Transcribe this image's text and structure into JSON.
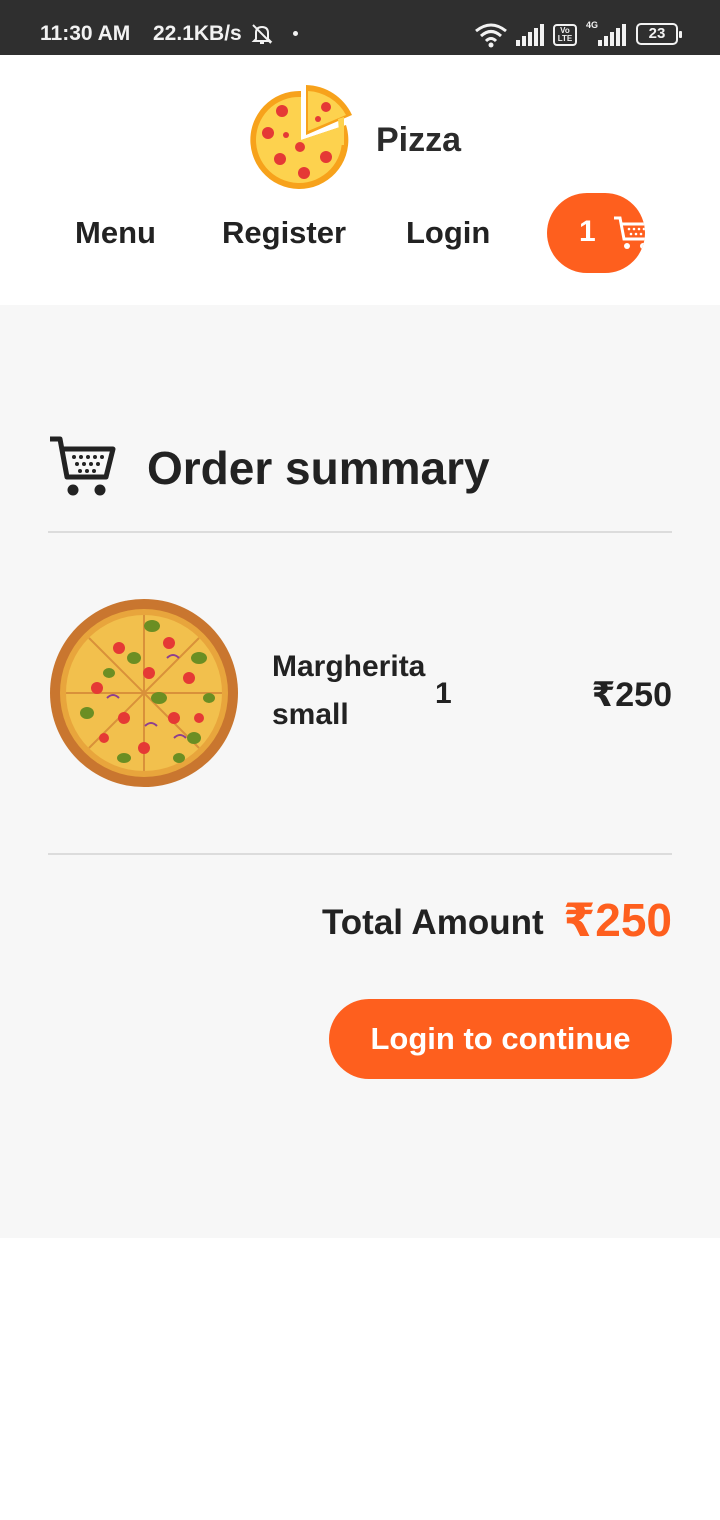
{
  "status_bar": {
    "time": "11:30 AM",
    "speed": "22.1KB/s",
    "volte": "Vo LTE",
    "network": "4G",
    "battery": "23"
  },
  "header": {
    "logo_text": "Pizza",
    "nav": {
      "menu": "Menu",
      "register": "Register",
      "login": "Login"
    },
    "cart_count": "1"
  },
  "order_summary": {
    "title": "Order summary",
    "items": [
      {
        "name": "Margherita",
        "size": "small",
        "quantity": "1",
        "price": "₹250"
      }
    ],
    "total_label": "Total Amount",
    "total_value": "₹250",
    "continue_button": "Login to continue"
  },
  "colors": {
    "accent": "#fe5f1e",
    "status_bar": "#2f2f2f",
    "main_bg": "#f7f7f7",
    "text": "#222222"
  },
  "icons": {
    "bell": "bell-off-icon",
    "wifi": "wifi-icon",
    "signal": "signal-icon",
    "cart": "cart-icon",
    "logo": "pizza-logo-icon"
  }
}
